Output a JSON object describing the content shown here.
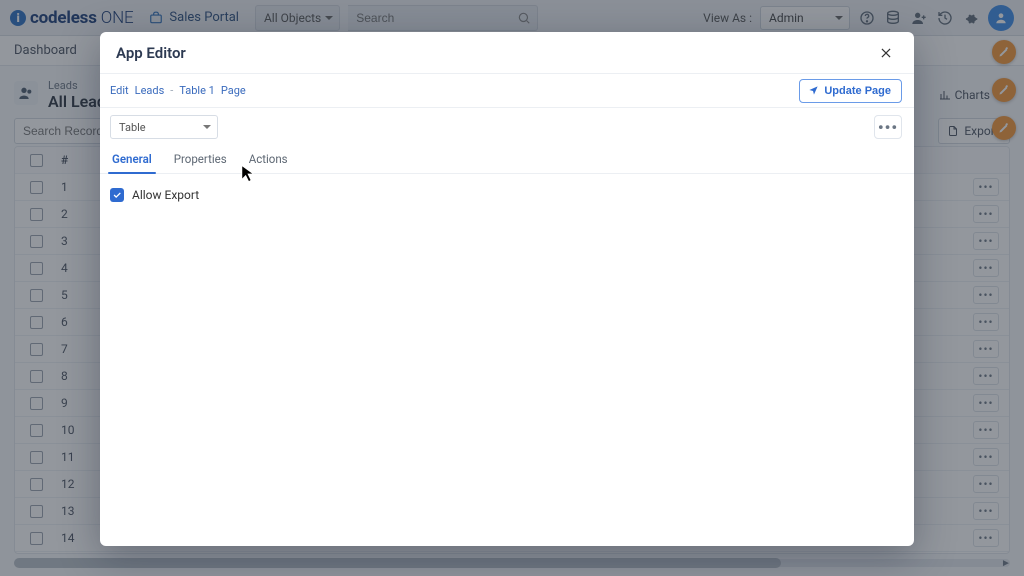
{
  "topbar": {
    "logo_brand": "codeless",
    "logo_suffix": "ONE",
    "portal_label": "Sales Portal",
    "objects_selector": "All Objects",
    "search_placeholder": "Search",
    "view_as_label": "View As :",
    "view_as_value": "Admin"
  },
  "subbar": {
    "dashboard_label": "Dashboard"
  },
  "page": {
    "crumb": "Leads",
    "title": "All Leads",
    "charts_btn": "Charts",
    "search_records_placeholder": "Search Records",
    "export_label": "Export"
  },
  "table": {
    "num_header": "#",
    "rows": [
      1,
      2,
      3,
      4,
      5,
      6,
      7,
      8,
      9,
      10,
      11,
      12,
      13,
      14
    ]
  },
  "modal": {
    "title": "App Editor",
    "breadcrumbs": [
      "Edit",
      "Leads",
      "Table 1",
      "Page"
    ],
    "update_btn": "Update Page",
    "component_selector": "Table",
    "tabs": {
      "general": "General",
      "properties": "Properties",
      "actions": "Actions"
    },
    "active_tab": "general",
    "allow_export_label": "Allow Export",
    "allow_export_checked": true
  }
}
